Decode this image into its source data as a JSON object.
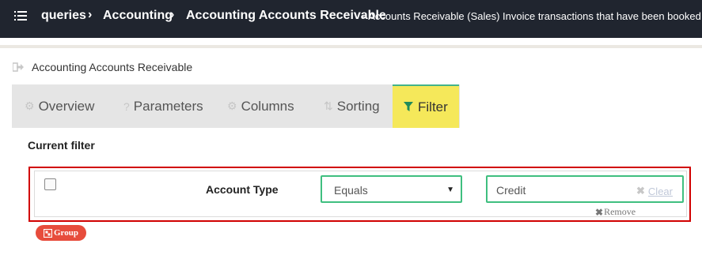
{
  "breadcrumb": {
    "items": [
      "queries",
      "Accounting",
      "Accounting Accounts Receivable"
    ],
    "description": "- Accounts Receivable (Sales) Invoice transactions that have been booked into t"
  },
  "page": {
    "title": "Accounting Accounts Receivable"
  },
  "tabs": [
    {
      "label": "Overview",
      "icon": "gears-icon"
    },
    {
      "label": "Parameters",
      "icon": "question-icon"
    },
    {
      "label": "Columns",
      "icon": "gears-icon"
    },
    {
      "label": "Sorting",
      "icon": "sort-icon"
    },
    {
      "label": "Filter",
      "icon": "filter-icon",
      "active": true
    }
  ],
  "filter": {
    "section_title": "Current filter",
    "row": {
      "field": "Account Type",
      "operator": "Equals",
      "value": "Credit",
      "clear_label": "Clear",
      "remove_label": "Remove"
    },
    "group_label": "Group"
  },
  "colors": {
    "topbar": "#20252f",
    "active_tab": "#f5e85a",
    "accent_green": "#3fbf7f",
    "highlight_red": "#d10000",
    "group_button": "#e74c3c"
  }
}
